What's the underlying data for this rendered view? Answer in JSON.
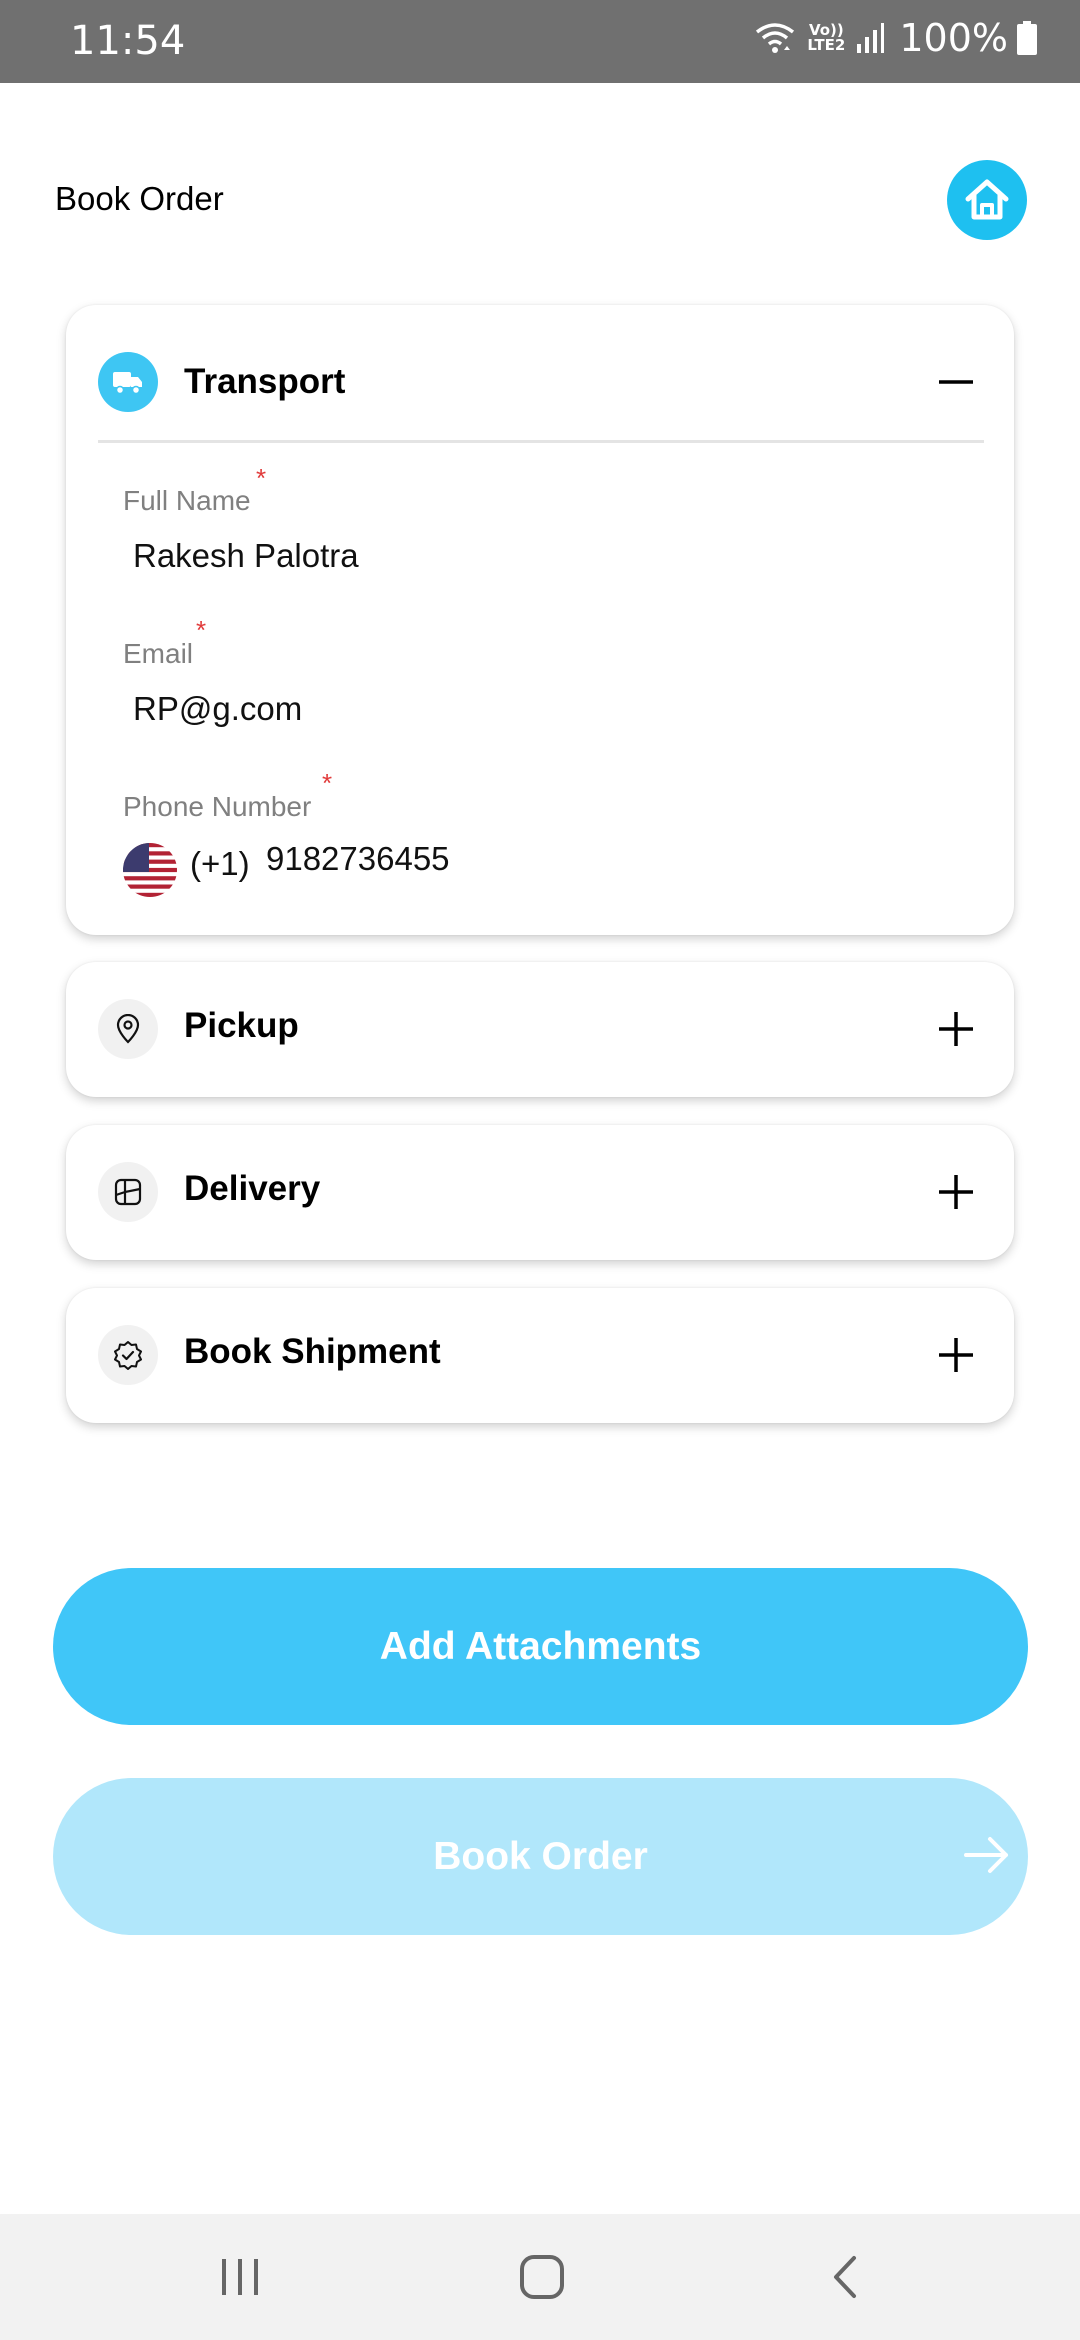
{
  "status_bar": {
    "time": "11:54",
    "network": "Vo)) LTE2",
    "battery": "100%",
    "icons": [
      "wifi-icon",
      "volte-icon",
      "signal-icon",
      "battery-icon"
    ]
  },
  "header": {
    "title": "Book Order",
    "home_icon": "home-icon"
  },
  "sections": {
    "transport": {
      "title": "Transport",
      "icon": "truck-icon",
      "expanded": true,
      "toggle": "minus-icon",
      "fields": {
        "full_name": {
          "label": "Full Name",
          "required": "*",
          "value": "Rakesh Palotra"
        },
        "email": {
          "label": "Email",
          "required": "*",
          "value": "RP@g.com"
        },
        "phone": {
          "label": "Phone Number",
          "required": "*",
          "flag": "us-flag-icon",
          "dial_code": "(+1)",
          "value": "9182736455"
        }
      }
    },
    "pickup": {
      "title": "Pickup",
      "icon": "location-pin-icon",
      "toggle": "plus-icon"
    },
    "delivery": {
      "title": "Delivery",
      "icon": "map-icon",
      "toggle": "plus-icon"
    },
    "shipment": {
      "title": "Book Shipment",
      "icon": "verified-badge-icon",
      "toggle": "plus-icon"
    }
  },
  "buttons": {
    "add_attachments": "Add Attachments",
    "book_order": "Book Order",
    "book_order_icon": "arrow-right-icon"
  },
  "nav": {
    "recent": "recent-apps-icon",
    "home": "home-nav-icon",
    "back": "back-icon"
  },
  "colors": {
    "accent": "#40c6f8",
    "accent_disabled": "#b1e7fb",
    "status_bar": "#707070",
    "required": "#e13b3b"
  }
}
